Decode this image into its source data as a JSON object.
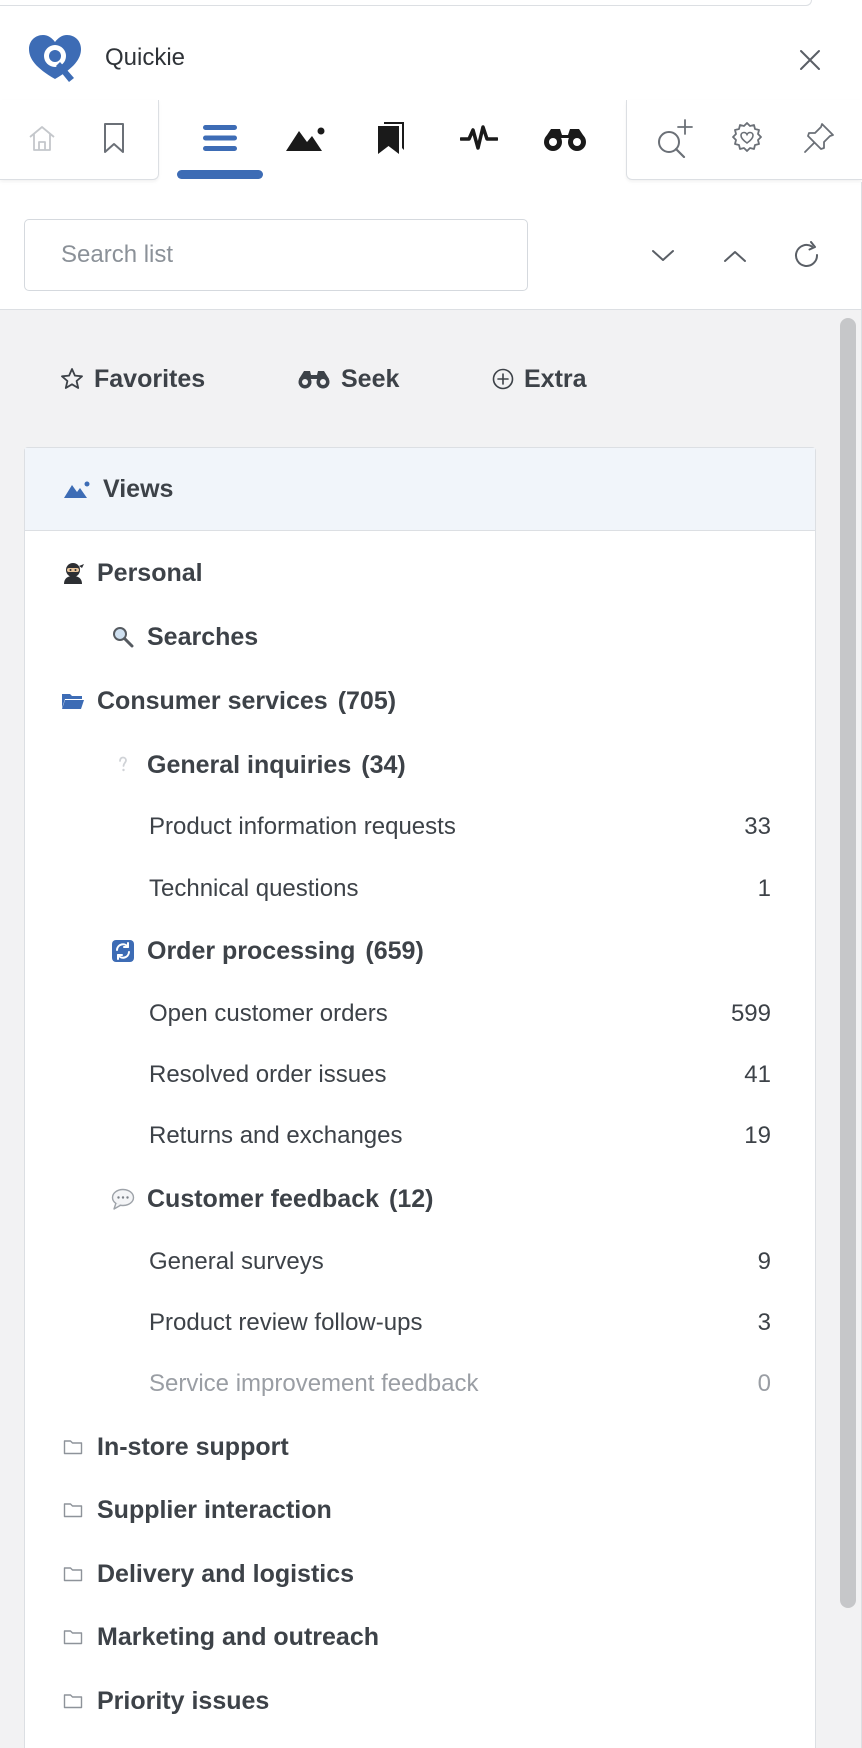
{
  "app": {
    "title": "Quickie",
    "brand_color": "#3d6cb5"
  },
  "toolbar": {
    "left_icons": [
      "home-icon",
      "bookmark-icon"
    ],
    "tabs": [
      "list-icon",
      "views-icon",
      "bookmarks-icon",
      "activity-icon",
      "binoculars-icon"
    ],
    "active_tab": "list-icon",
    "right_icons": [
      "search-add-icon",
      "settings-icon",
      "pin-icon"
    ]
  },
  "search": {
    "placeholder": "Search list"
  },
  "quick_links": [
    {
      "label": "Favorites",
      "icon": "star-icon"
    },
    {
      "label": "Seek",
      "icon": "binoculars-icon"
    },
    {
      "label": "Extra",
      "icon": "plus-circle-icon"
    }
  ],
  "views": {
    "title": "Views",
    "personal": {
      "label": "Personal",
      "searches": "Searches"
    },
    "consumer": {
      "label": "Consumer services",
      "count": "(705)",
      "general": {
        "label": "General inquiries",
        "count": "(34)",
        "items": [
          {
            "label": "Product information requests",
            "count": "33"
          },
          {
            "label": "Technical questions",
            "count": "1"
          }
        ]
      },
      "orders": {
        "label": "Order processing",
        "count": "(659)",
        "items": [
          {
            "label": "Open customer orders",
            "count": "599"
          },
          {
            "label": "Resolved order issues",
            "count": "41"
          },
          {
            "label": "Returns and exchanges",
            "count": "19"
          }
        ]
      },
      "feedback": {
        "label": "Customer feedback",
        "count": "(12)",
        "items": [
          {
            "label": "General surveys",
            "count": "9"
          },
          {
            "label": "Product review follow-ups",
            "count": "3"
          },
          {
            "label": "Service improvement feedback",
            "count": "0"
          }
        ]
      }
    },
    "folders": [
      "In-store support",
      "Supplier interaction",
      "Delivery and logistics",
      "Marketing and outreach",
      "Priority issues"
    ]
  }
}
